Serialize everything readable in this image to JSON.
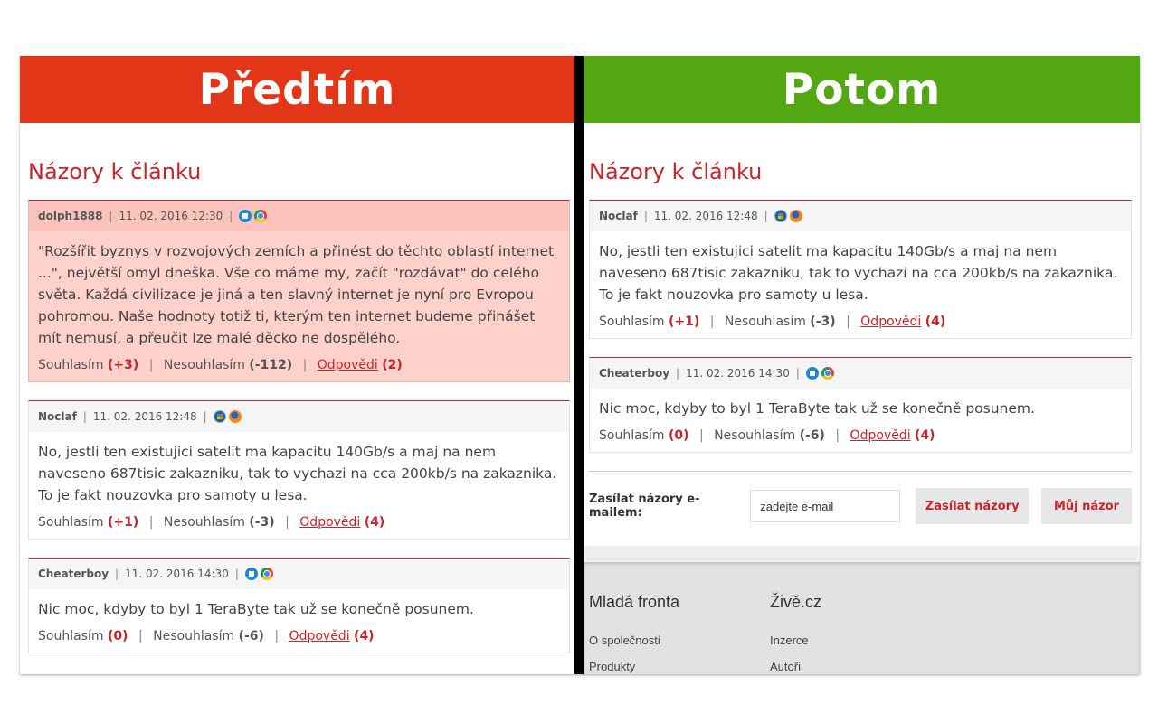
{
  "before": {
    "banner": "Předtím",
    "section_title": "Názory k článku",
    "comments": [
      {
        "author": "dolph1888",
        "date": "11. 02. 2016 12:30",
        "os_icon": "windows-10-icon",
        "browser_icon": "chrome-icon",
        "text": "\"Rozšířit byznys v rozvojových zemích a přinést do těchto oblastí internet ...\", největší omyl dneška. Vše co máme my, začít \"rozdávat\" do celého světa. Každá civilizace je jiná a ten slavný internet je nyní pro Evropou pohromou. Naše hodnoty totiž ti, kterým ten internet budeme přinášet mít nemusí, a přeučit lze malé děcko ne dospělého.",
        "agree_label": "Souhlasím",
        "agree_count": "(+3)",
        "disagree_label": "Nesouhlasím",
        "disagree_count": "(-112)",
        "reply_label": "Odpovědi",
        "reply_count": "(2)"
      },
      {
        "author": "Noclaf",
        "date": "11. 02. 2016 12:48",
        "os_icon": "windows-7-icon",
        "browser_icon": "firefox-icon",
        "text": "No, jestli ten existujici satelit ma kapacitu 140Gb/s a maj na nem naveseno 687tisic zakazniku, tak to vychazi na cca 200kb/s na zakaznika. To je fakt nouzovka pro samoty u lesa.",
        "agree_label": "Souhlasím",
        "agree_count": "(+1)",
        "disagree_label": "Nesouhlasím",
        "disagree_count": "(-3)",
        "reply_label": "Odpovědi",
        "reply_count": "(4)"
      },
      {
        "author": "Cheaterboy",
        "date": "11. 02. 2016 14:30",
        "os_icon": "windows-10-icon",
        "browser_icon": "chrome-icon",
        "text": "Nic moc, kdyby to byl 1 TeraByte tak už se konečně posunem.",
        "agree_label": "Souhlasím",
        "agree_count": "(0)",
        "disagree_label": "Nesouhlasím",
        "disagree_count": "(-6)",
        "reply_label": "Odpovědi",
        "reply_count": "(4)"
      }
    ]
  },
  "after": {
    "banner": "Potom",
    "section_title": "Názory k článku",
    "comments": [
      {
        "author": "Noclaf",
        "date": "11. 02. 2016 12:48",
        "os_icon": "windows-7-icon",
        "browser_icon": "firefox-icon",
        "text": "No, jestli ten existujici satelit ma kapacitu 140Gb/s a maj na nem naveseno 687tisic zakazniku, tak to vychazi na cca 200kb/s na zakaznika. To je fakt nouzovka pro samoty u lesa.",
        "agree_label": "Souhlasím",
        "agree_count": "(+1)",
        "disagree_label": "Nesouhlasím",
        "disagree_count": "(-3)",
        "reply_label": "Odpovědi",
        "reply_count": "(4)"
      },
      {
        "author": "Cheaterboy",
        "date": "11. 02. 2016 14:30",
        "os_icon": "windows-10-icon",
        "browser_icon": "chrome-icon",
        "text": "Nic moc, kdyby to byl 1 TeraByte tak už se konečně posunem.",
        "agree_label": "Souhlasím",
        "agree_count": "(0)",
        "disagree_label": "Nesouhlasím",
        "disagree_count": "(-6)",
        "reply_label": "Odpovědi",
        "reply_count": "(4)"
      }
    ],
    "subscribe": {
      "label": "Zasílat názory e-mailem:",
      "email_value": "zadejte e-mail",
      "subscribe_button": "Zasílat názory",
      "opinion_button": "Můj názor"
    },
    "footer": {
      "col1_title": "Mladá fronta",
      "col1_links": [
        "O společnosti",
        "Produkty"
      ],
      "col2_title": "Živě.cz",
      "col2_links": [
        "Inzerce",
        "Autoři"
      ]
    }
  },
  "colors": {
    "before_banner": "#e33518",
    "after_banner": "#53a712",
    "accent": "#c8242a",
    "highlight": "#ffd1cb"
  }
}
